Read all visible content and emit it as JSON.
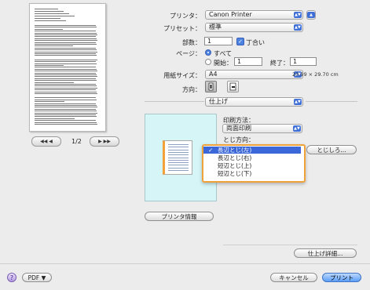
{
  "header": {
    "printer_label": "プリンタ：",
    "printer_value": "Canon Printer",
    "preset_label": "プリセット：",
    "preset_value": "標準"
  },
  "copies": {
    "label": "部数：",
    "value": "1",
    "collate_label": "丁合い",
    "collate_checked": true
  },
  "pages": {
    "label": "ページ：",
    "all_label": "すべて",
    "range_label": "開始：",
    "from_value": "1",
    "to_label": "終了：",
    "to_value": "1",
    "selected": "all"
  },
  "paper": {
    "label": "用紙サイズ：",
    "value": "A4",
    "dimensions": "20.99 × 29.70 cm"
  },
  "orientation": {
    "label": "方向："
  },
  "panel": {
    "value": "仕上げ"
  },
  "preview": {
    "page_indicator": "1/2",
    "prev_label": "◀◀  ◀",
    "next_label": "▶  ▶▶"
  },
  "finishing": {
    "print_method_label": "印刷方法：",
    "print_method_value": "両面印刷",
    "binding_label": "とじ方向：",
    "binding_options": [
      "長辺とじ(左)",
      "長辺とじ(右)",
      "短辺とじ(上)",
      "短辺とじ(下)"
    ],
    "binding_selected_index": 0,
    "margin_button": "とじしろ...",
    "printer_info_button": "プリンタ情報",
    "details_button": "仕上げ詳細..."
  },
  "footer": {
    "help_glyph": "?",
    "pdf_button": "PDF ▼",
    "cancel_button": "キャンセル",
    "print_button": "プリント"
  },
  "colors": {
    "accent": "#3c67d8",
    "dropdown_border": "#f0a23a",
    "preview_bg": "#d6f5f7"
  }
}
